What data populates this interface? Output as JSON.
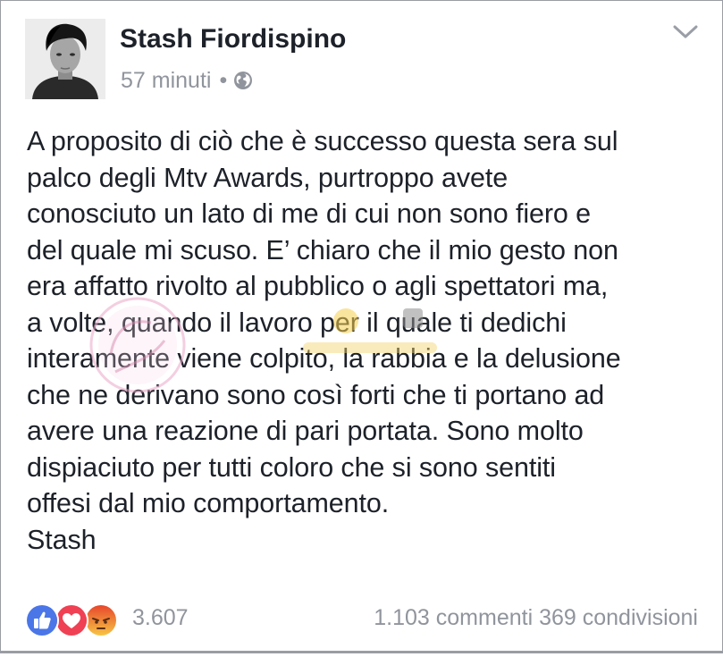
{
  "post": {
    "author": "Stash Fiordispino",
    "time": "57 minuti",
    "separator": "•",
    "privacy_icon": "globe-icon",
    "menu_icon": "chevron-down-icon",
    "lines": [
      "A proposito di ciò che è successo questa sera sul",
      "palco degli Mtv Awards, purtroppo avete",
      "conosciuto un lato di me di cui non sono fiero e",
      "del quale mi  scuso. E’ chiaro che il mio gesto non",
      "era affatto rivolto al pubblico o agli spettatori ma,",
      "a volte, quando il lavoro per il quale ti dedichi",
      "interamente viene colpito, la  rabbia e la delusione",
      "che ne derivano  sono così forti che ti portano ad",
      "avere una reazione di pari portata. Sono molto",
      "dispiaciuto per tutti coloro che si sono sentiti",
      "offesi  dal mio comportamento.",
      "Stash"
    ]
  },
  "footer": {
    "reactions": [
      "like-icon",
      "love-icon",
      "angry-icon"
    ],
    "reaction_count": "3.607",
    "comments": "1.103 commenti",
    "shares": "369 condivisioni"
  },
  "colors": {
    "like": "#4a76e8",
    "love": "#ef4153",
    "angry": "#f09a22",
    "text": "#1d2129",
    "muted": "#90949c"
  }
}
